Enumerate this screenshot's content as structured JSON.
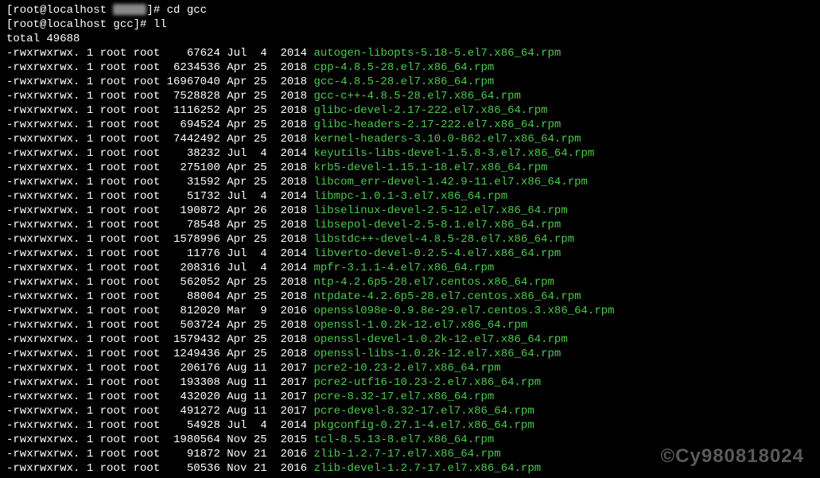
{
  "prompts": [
    {
      "prefix": "[root@localhost ",
      "blurred": true,
      "suffix": "]# ",
      "command": "cd gcc"
    },
    {
      "prefix": "[root@localhost gcc]# ",
      "blurred": false,
      "suffix": "",
      "command": "ll"
    }
  ],
  "total_line": "total 49688",
  "files": [
    {
      "perms": "-rwxrwxrwx.",
      "links": "1",
      "owner": "root",
      "group": "root",
      "size": "67624",
      "month": "Jul",
      "day": "4",
      "year": "2014",
      "name": "autogen-libopts-5.18-5.el7.x86_64.rpm"
    },
    {
      "perms": "-rwxrwxrwx.",
      "links": "1",
      "owner": "root",
      "group": "root",
      "size": "6234536",
      "month": "Apr",
      "day": "25",
      "year": "2018",
      "name": "cpp-4.8.5-28.el7.x86_64.rpm"
    },
    {
      "perms": "-rwxrwxrwx.",
      "links": "1",
      "owner": "root",
      "group": "root",
      "size": "16967040",
      "month": "Apr",
      "day": "25",
      "year": "2018",
      "name": "gcc-4.8.5-28.el7.x86_64.rpm"
    },
    {
      "perms": "-rwxrwxrwx.",
      "links": "1",
      "owner": "root",
      "group": "root",
      "size": "7528828",
      "month": "Apr",
      "day": "25",
      "year": "2018",
      "name": "gcc-c++-4.8.5-28.el7.x86_64.rpm"
    },
    {
      "perms": "-rwxrwxrwx.",
      "links": "1",
      "owner": "root",
      "group": "root",
      "size": "1116252",
      "month": "Apr",
      "day": "25",
      "year": "2018",
      "name": "glibc-devel-2.17-222.el7.x86_64.rpm"
    },
    {
      "perms": "-rwxrwxrwx.",
      "links": "1",
      "owner": "root",
      "group": "root",
      "size": "694524",
      "month": "Apr",
      "day": "25",
      "year": "2018",
      "name": "glibc-headers-2.17-222.el7.x86_64.rpm"
    },
    {
      "perms": "-rwxrwxrwx.",
      "links": "1",
      "owner": "root",
      "group": "root",
      "size": "7442492",
      "month": "Apr",
      "day": "25",
      "year": "2018",
      "name": "kernel-headers-3.10.0-862.el7.x86_64.rpm"
    },
    {
      "perms": "-rwxrwxrwx.",
      "links": "1",
      "owner": "root",
      "group": "root",
      "size": "38232",
      "month": "Jul",
      "day": "4",
      "year": "2014",
      "name": "keyutils-libs-devel-1.5.8-3.el7.x86_64.rpm"
    },
    {
      "perms": "-rwxrwxrwx.",
      "links": "1",
      "owner": "root",
      "group": "root",
      "size": "275100",
      "month": "Apr",
      "day": "25",
      "year": "2018",
      "name": "krb5-devel-1.15.1-18.el7.x86_64.rpm"
    },
    {
      "perms": "-rwxrwxrwx.",
      "links": "1",
      "owner": "root",
      "group": "root",
      "size": "31592",
      "month": "Apr",
      "day": "25",
      "year": "2018",
      "name": "libcom_err-devel-1.42.9-11.el7.x86_64.rpm"
    },
    {
      "perms": "-rwxrwxrwx.",
      "links": "1",
      "owner": "root",
      "group": "root",
      "size": "51732",
      "month": "Jul",
      "day": "4",
      "year": "2014",
      "name": "libmpc-1.0.1-3.el7.x86_64.rpm"
    },
    {
      "perms": "-rwxrwxrwx.",
      "links": "1",
      "owner": "root",
      "group": "root",
      "size": "190872",
      "month": "Apr",
      "day": "26",
      "year": "2018",
      "name": "libselinux-devel-2.5-12.el7.x86_64.rpm"
    },
    {
      "perms": "-rwxrwxrwx.",
      "links": "1",
      "owner": "root",
      "group": "root",
      "size": "78548",
      "month": "Apr",
      "day": "25",
      "year": "2018",
      "name": "libsepol-devel-2.5-8.1.el7.x86_64.rpm"
    },
    {
      "perms": "-rwxrwxrwx.",
      "links": "1",
      "owner": "root",
      "group": "root",
      "size": "1578996",
      "month": "Apr",
      "day": "25",
      "year": "2018",
      "name": "libstdc++-devel-4.8.5-28.el7.x86_64.rpm"
    },
    {
      "perms": "-rwxrwxrwx.",
      "links": "1",
      "owner": "root",
      "group": "root",
      "size": "11776",
      "month": "Jul",
      "day": "4",
      "year": "2014",
      "name": "libverto-devel-0.2.5-4.el7.x86_64.rpm"
    },
    {
      "perms": "-rwxrwxrwx.",
      "links": "1",
      "owner": "root",
      "group": "root",
      "size": "208316",
      "month": "Jul",
      "day": "4",
      "year": "2014",
      "name": "mpfr-3.1.1-4.el7.x86_64.rpm"
    },
    {
      "perms": "-rwxrwxrwx.",
      "links": "1",
      "owner": "root",
      "group": "root",
      "size": "562052",
      "month": "Apr",
      "day": "25",
      "year": "2018",
      "name": "ntp-4.2.6p5-28.el7.centos.x86_64.rpm"
    },
    {
      "perms": "-rwxrwxrwx.",
      "links": "1",
      "owner": "root",
      "group": "root",
      "size": "88004",
      "month": "Apr",
      "day": "25",
      "year": "2018",
      "name": "ntpdate-4.2.6p5-28.el7.centos.x86_64.rpm"
    },
    {
      "perms": "-rwxrwxrwx.",
      "links": "1",
      "owner": "root",
      "group": "root",
      "size": "812020",
      "month": "Mar",
      "day": "9",
      "year": "2016",
      "name": "openssl098e-0.9.8e-29.el7.centos.3.x86_64.rpm"
    },
    {
      "perms": "-rwxrwxrwx.",
      "links": "1",
      "owner": "root",
      "group": "root",
      "size": "503724",
      "month": "Apr",
      "day": "25",
      "year": "2018",
      "name": "openssl-1.0.2k-12.el7.x86_64.rpm"
    },
    {
      "perms": "-rwxrwxrwx.",
      "links": "1",
      "owner": "root",
      "group": "root",
      "size": "1579432",
      "month": "Apr",
      "day": "25",
      "year": "2018",
      "name": "openssl-devel-1.0.2k-12.el7.x86_64.rpm"
    },
    {
      "perms": "-rwxrwxrwx.",
      "links": "1",
      "owner": "root",
      "group": "root",
      "size": "1249436",
      "month": "Apr",
      "day": "25",
      "year": "2018",
      "name": "openssl-libs-1.0.2k-12.el7.x86_64.rpm"
    },
    {
      "perms": "-rwxrwxrwx.",
      "links": "1",
      "owner": "root",
      "group": "root",
      "size": "206176",
      "month": "Aug",
      "day": "11",
      "year": "2017",
      "name": "pcre2-10.23-2.el7.x86_64.rpm"
    },
    {
      "perms": "-rwxrwxrwx.",
      "links": "1",
      "owner": "root",
      "group": "root",
      "size": "193308",
      "month": "Aug",
      "day": "11",
      "year": "2017",
      "name": "pcre2-utf16-10.23-2.el7.x86_64.rpm"
    },
    {
      "perms": "-rwxrwxrwx.",
      "links": "1",
      "owner": "root",
      "group": "root",
      "size": "432020",
      "month": "Aug",
      "day": "11",
      "year": "2017",
      "name": "pcre-8.32-17.el7.x86_64.rpm"
    },
    {
      "perms": "-rwxrwxrwx.",
      "links": "1",
      "owner": "root",
      "group": "root",
      "size": "491272",
      "month": "Aug",
      "day": "11",
      "year": "2017",
      "name": "pcre-devel-8.32-17.el7.x86_64.rpm"
    },
    {
      "perms": "-rwxrwxrwx.",
      "links": "1",
      "owner": "root",
      "group": "root",
      "size": "54928",
      "month": "Jul",
      "day": "4",
      "year": "2014",
      "name": "pkgconfig-0.27.1-4.el7.x86_64.rpm"
    },
    {
      "perms": "-rwxrwxrwx.",
      "links": "1",
      "owner": "root",
      "group": "root",
      "size": "1980564",
      "month": "Nov",
      "day": "25",
      "year": "2015",
      "name": "tcl-8.5.13-8.el7.x86_64.rpm"
    },
    {
      "perms": "-rwxrwxrwx.",
      "links": "1",
      "owner": "root",
      "group": "root",
      "size": "91872",
      "month": "Nov",
      "day": "21",
      "year": "2016",
      "name": "zlib-1.2.7-17.el7.x86_64.rpm"
    },
    {
      "perms": "-rwxrwxrwx.",
      "links": "1",
      "owner": "root",
      "group": "root",
      "size": "50536",
      "month": "Nov",
      "day": "21",
      "year": "2016",
      "name": "zlib-devel-1.2.7-17.el7.x86_64.rpm"
    }
  ],
  "watermark": "©Cy980818024"
}
